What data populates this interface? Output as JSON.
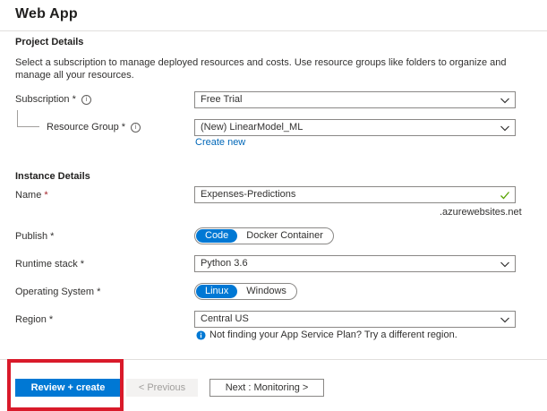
{
  "window": {
    "title": "Web App"
  },
  "project": {
    "heading": "Project Details",
    "description": "Select a subscription to manage deployed resources and costs. Use resource groups like folders to organize and manage all your resources.",
    "subscription_label": "Subscription *",
    "subscription_value": "Free Trial",
    "resource_group_label": "Resource Group *",
    "resource_group_value": "(New) LinearModel_ML",
    "create_new": "Create new"
  },
  "instance": {
    "heading": "Instance Details",
    "name_label": "Name",
    "required_mark": "*",
    "name_value": "Expenses-Predictions",
    "domain_suffix": ".azurewebsites.net",
    "publish_label": "Publish *",
    "publish_options": [
      "Code",
      "Docker Container"
    ],
    "publish_selected": "Code",
    "runtime_label": "Runtime stack *",
    "runtime_value": "Python 3.6",
    "os_label": "Operating System *",
    "os_options": [
      "Linux",
      "Windows"
    ],
    "os_selected": "Linux",
    "region_label": "Region *",
    "region_value": "Central US",
    "region_notice": "Not finding your App Service Plan? Try a different region."
  },
  "footer": {
    "review_create": "Review + create",
    "previous": "< Previous",
    "next": "Next : Monitoring >"
  },
  "colors": {
    "accent": "#0078d4",
    "link": "#0067b8",
    "highlight_box": "#d91a2a",
    "required": "#a4262c"
  },
  "icons": {
    "info": "info-icon",
    "chevron": "chevron-down-icon",
    "check": "checkmark-icon",
    "notice": "info-filled-icon"
  }
}
